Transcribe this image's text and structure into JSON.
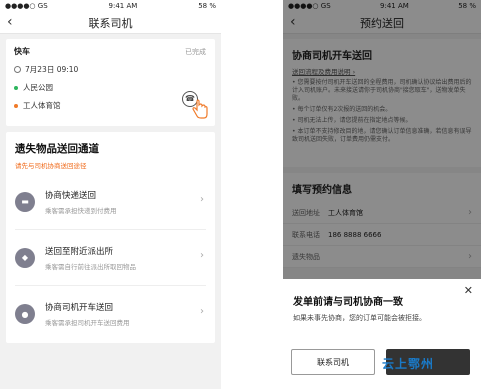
{
  "left": {
    "status": {
      "carrier": "●●●●○ GS",
      "time": "9:41 AM",
      "battery": "58 %"
    },
    "nav": {
      "back": "‹",
      "title": "联系司机"
    },
    "trip": {
      "type": "快车",
      "state": "已完成",
      "time": "7月23日 09:10",
      "from": "人民公园",
      "to": "工人体育馆",
      "from_color": "#2db55d",
      "to_color": "#f07a29"
    },
    "lost": {
      "title": "遗失物品送回通道",
      "subtitle": "请先与司机协商送回途径",
      "options": [
        {
          "title": "协商快递送回",
          "desc": "乘客需承担快递到付费用"
        },
        {
          "title": "送回至附近派出所",
          "desc": "乘客需自行前往派出所取回物品"
        },
        {
          "title": "协商司机开车送回",
          "desc": "乘客需承担司机开车送回费用"
        }
      ]
    }
  },
  "right": {
    "status": {
      "carrier": "●●●●○ GS",
      "time": "9:41 AM",
      "battery": "58 %"
    },
    "nav": {
      "back": "‹",
      "title": "预约送回"
    },
    "card": {
      "title": "协商司机开车送回",
      "link": "送回流程及费用说明 ›",
      "bullets": [
        "• 您需要按付司机开车送回的全程费用，司机确认协议给出费用后的计入司机账户。未来接送请你于司机协商\"接您取车\"，送物发单失败。",
        "• 每个订单仅有2次报的送回的机会。",
        "• 司机无法上传，请您提前在指定地点等候。",
        "• 本订单不支持修改目的地，请您确认订单信息准确，若信息有误导致司机送回失败，订单费用仍需支付。"
      ]
    },
    "form": {
      "title": "填写预约信息",
      "fields": [
        {
          "k": "送回地址",
          "v": "工人体育馆"
        },
        {
          "k": "联系电话",
          "v": "186 8888 6666"
        },
        {
          "k": "遗失物品",
          "v": ""
        }
      ]
    },
    "sheet": {
      "title": "发单前请与司机协商一致",
      "desc": "如果未事先协商，您的订单可能会被拒接。",
      "close": "✕",
      "btn_contact": "联系司机",
      "btn_confirm": ""
    }
  },
  "watermark": "云上鄂州"
}
